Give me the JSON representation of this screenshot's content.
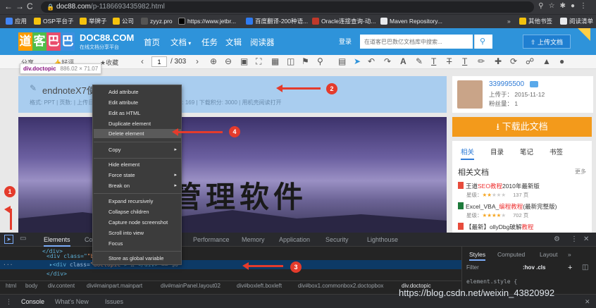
{
  "browser": {
    "url_host": "doc88.com",
    "url_path": "/p-1186693435982.html",
    "nav_icons": [
      "←",
      "→",
      "C"
    ],
    "bookmarks": [
      {
        "label": "应用",
        "color": "#4285f4"
      },
      {
        "label": "OSP平台子",
        "color": "#f4c20d"
      },
      {
        "label": "举牌子",
        "color": "#f4c20d"
      },
      {
        "label": "公司",
        "color": "#f4c20d"
      },
      {
        "label": "zyyz.pro",
        "color": "#555555"
      },
      {
        "label": "https://www.jetbr...",
        "color": "#000000"
      },
      {
        "label": "百度翻译-200种语...",
        "color": "#2f7bf0"
      },
      {
        "label": "Oracle连接查询-动...",
        "color": "#c0392b"
      },
      {
        "label": "Maven Repository...",
        "color": "#e8eaed"
      },
      {
        "label": "其他书签",
        "color": "#f4c20d"
      },
      {
        "label": "阅读清单",
        "color": "#e8eaed"
      }
    ]
  },
  "site": {
    "logo_chars": [
      "道",
      "客",
      "巴",
      "巴"
    ],
    "logo_colors": [
      "#ff9c00",
      "#4fbd4a",
      "#e84d6c",
      "#3c8fe0"
    ],
    "brand": "DOC88.COM",
    "brand_sub": "在线文档分享平台",
    "nav": [
      "首页",
      "文档",
      "任务",
      "文辑",
      "阅读器"
    ],
    "login": "登录",
    "search_placeholder": "在道客巴巴数亿文档库中搜索...",
    "upload_label": "上传文档"
  },
  "toolbar": {
    "left_labels": [
      "分享",
      "好评",
      "收藏"
    ],
    "page_current": "1",
    "page_total": "/ 303"
  },
  "tooltip": {
    "name": "div.doctopic",
    "dims": "886.02 × 71.07"
  },
  "doc": {
    "title": "endnoteX7使用",
    "meta": "格式: PPT  |  页数:  |  上传日期: 2016-10-23 12:47:04  |  浏览次数: 169  |  下载积分: 3000  |  用机壳阅读打开",
    "page_text": "管理软件"
  },
  "user": {
    "name": "339995500",
    "upload_time": "上传于： 2015-11-12",
    "fans": "粉丝量： 1"
  },
  "download": {
    "label": "下载此文档"
  },
  "right_panel": {
    "tabs": [
      "相关",
      "目录",
      "笔记",
      "书签"
    ],
    "related_title": "相关文档",
    "more": "更多",
    "items": [
      {
        "pre": "王道",
        "hl": "SEO教程",
        "post": "2010年最新版",
        "meta": "星级：",
        "stars": 2,
        "pages": "137 页",
        "icon": "#e74c3c"
      },
      {
        "pre": "Excel_VBA_",
        "hl": "编程教程",
        "post": "(最新完整版)",
        "meta": "星级：",
        "stars": 4,
        "pages": "702 页",
        "icon": "#1d7a3a"
      },
      {
        "pre": "【最新】ollyDbg破解",
        "hl": "教程",
        "post": "",
        "meta": "",
        "stars": 0,
        "pages": "",
        "icon": "#e74c3c"
      }
    ]
  },
  "context_menu": {
    "items": [
      {
        "label": "Add attribute",
        "arrow": false
      },
      {
        "label": "Edit attribute",
        "arrow": false
      },
      {
        "label": "Edit as HTML",
        "arrow": false
      },
      {
        "label": "Duplicate element",
        "arrow": false
      },
      {
        "label": "Delete element",
        "arrow": false
      },
      {
        "label": "Copy",
        "arrow": true
      },
      {
        "label": "Hide element",
        "arrow": false
      },
      {
        "label": "Force state",
        "arrow": true
      },
      {
        "label": "Break on",
        "arrow": true
      },
      {
        "label": "Expand recursively",
        "arrow": false
      },
      {
        "label": "Collapse children",
        "arrow": false
      },
      {
        "label": "Capture node screenshot",
        "arrow": false
      },
      {
        "label": "Scroll into view",
        "arrow": false
      },
      {
        "label": "Focus",
        "arrow": false
      },
      {
        "label": "Store as global variable",
        "arrow": false
      }
    ]
  },
  "annotations": [
    "1",
    "2",
    "3",
    "4"
  ],
  "devtools": {
    "tabs": [
      "Elements",
      "Co",
      "Performance",
      "Memory",
      "Application",
      "Security",
      "Lighthouse"
    ],
    "code_lines": [
      {
        "pre": "<div class=\"",
        "val": "\"",
        "post": "box1\">"
      },
      {
        "pre": "▶<div class=\"doctopic\" ",
        "val": "...",
        "post": "</div> == $0"
      },
      {
        "pre": "</div>",
        "val": "",
        "post": ""
      }
    ],
    "styles_tabs": [
      "Styles",
      "Computed",
      "Layout",
      "»"
    ],
    "filter": "Filter",
    "hov": ":hov .cls",
    "element_style": "element.style {",
    "breadcrumb": [
      "html",
      "body",
      "div.content",
      "div#mainpart.mainpart",
      "div#mainPanel.layout02",
      "div#boxleft.boxleft",
      "div#box1.commonbox2.doctopbox",
      "div.doctopic"
    ],
    "console_tabs": [
      "Console",
      "What's New",
      "Issues"
    ]
  },
  "watermark": "https://blog.csdn.net/weixin_43820992"
}
